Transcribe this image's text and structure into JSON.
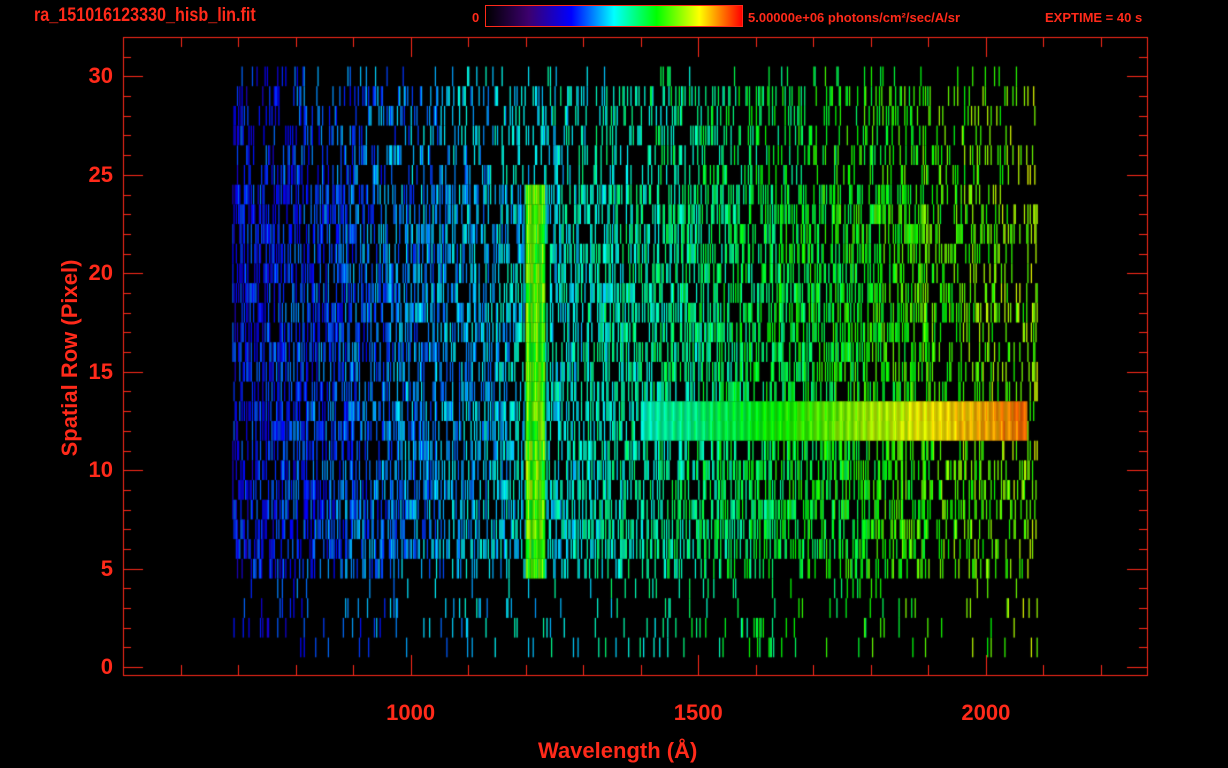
{
  "header": {
    "filename": "ra_151016123330_hisb_lin.fit",
    "colorbar_min_label": "0",
    "colorbar_max_label": "5.00000e+06 photons/cm²/sec/A/sr",
    "exptime": "EXPTIME = 40 s"
  },
  "chart_data": {
    "type": "heatmap",
    "xlabel": "Wavelength (Å)",
    "ylabel": "Spatial Row (Pixel)",
    "xlim": [
      500,
      2280
    ],
    "ylim": [
      -0.4,
      32
    ],
    "xticks": [
      {
        "v": 1000,
        "label": "1000"
      },
      {
        "v": 1500,
        "label": "1500"
      },
      {
        "v": 2000,
        "label": "2000"
      }
    ],
    "yticks": [
      {
        "v": 0,
        "label": "0"
      },
      {
        "v": 5,
        "label": "5"
      },
      {
        "v": 10,
        "label": "10"
      },
      {
        "v": 15,
        "label": "15"
      },
      {
        "v": 20,
        "label": "20"
      },
      {
        "v": 25,
        "label": "25"
      },
      {
        "v": 30,
        "label": "30"
      }
    ],
    "colorbar": {
      "min": 0,
      "max": 5000000,
      "units": "photons/cm^2/sec/A/sr",
      "colormap": "rainbow"
    },
    "data_extent": {
      "wavelength": [
        690,
        2090
      ],
      "rows": [
        0,
        30
      ]
    },
    "features": [
      {
        "name": "emission line",
        "wavelength": 1216,
        "rows": [
          5,
          24
        ],
        "level": 0.65
      },
      {
        "name": "continuum",
        "wavelength": [
          1400,
          2070
        ],
        "rows": [
          12,
          13
        ],
        "level_start": 0.45,
        "level_end": 0.9
      }
    ],
    "colors": {
      "axis": "#ff2a1a",
      "background": "#000000"
    }
  }
}
